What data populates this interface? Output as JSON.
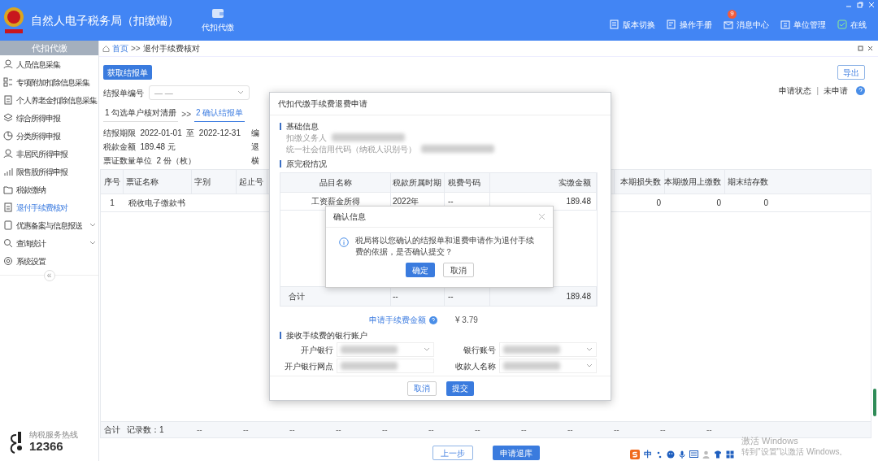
{
  "app": {
    "title": "自然人电子税务局（扣缴端）",
    "module_tab": "代扣代缴"
  },
  "header_actions": [
    {
      "label": "版本切换"
    },
    {
      "label": "操作手册"
    },
    {
      "label": "消息中心",
      "badge": "9"
    },
    {
      "label": "单位管理"
    },
    {
      "label": "在线"
    }
  ],
  "sidebar": {
    "title": "代扣代缴",
    "items": [
      {
        "label": "人员信息采集",
        "selected": false,
        "expandable": false
      },
      {
        "label": "专项附加扣除信息采集",
        "selected": false,
        "expandable": false
      },
      {
        "label": "个人养老金扣除信息采集",
        "selected": false,
        "expandable": false
      },
      {
        "label": "综合所得申报",
        "selected": false,
        "expandable": false
      },
      {
        "label": "分类所得申报",
        "selected": false,
        "expandable": false
      },
      {
        "label": "非居民所得申报",
        "selected": false,
        "expandable": false
      },
      {
        "label": "限售股所得申报",
        "selected": false,
        "expandable": false
      },
      {
        "label": "税款缴纳",
        "selected": false,
        "expandable": false
      },
      {
        "label": "退付手续费核对",
        "selected": true,
        "expandable": false
      },
      {
        "label": "优惠备案与信息报送",
        "selected": false,
        "expandable": true
      },
      {
        "label": "查询统计",
        "selected": false,
        "expandable": true
      },
      {
        "label": "系统设置",
        "selected": false,
        "expandable": false
      }
    ],
    "collapse": "«",
    "hotline_label": "纳税服务热线",
    "hotline": "12366"
  },
  "breadcrumb": {
    "home": "首页",
    "separator": ">>",
    "current": "退付手续费核对"
  },
  "toolbar": {
    "fetch_button": "获取结报单",
    "export_button": "导出",
    "status_label": "申请状态",
    "status_separator": "|",
    "status_value": "未申请"
  },
  "report_no": {
    "label": "结报单编号",
    "placeholder": "— —"
  },
  "steps": [
    {
      "label": "1 勾选单户核对清册",
      "selected": false
    },
    {
      "label": "2 确认结报单",
      "selected": true
    }
  ],
  "step_separator": ">>",
  "summary": [
    {
      "label": "结报期限",
      "value": "2022-01-01  至  2022-12-31",
      "cut": "编"
    },
    {
      "label": "税款金额",
      "value": "189.48 元",
      "cut": "退"
    },
    {
      "label": "票证数量单位",
      "value": "2 份（枚）",
      "cut": "横"
    }
  ],
  "table": {
    "columns_left": [
      "序号",
      "票证名称",
      "字别",
      "起止号"
    ],
    "columns_right": [
      "本期损失数",
      "本期缴用上缴数",
      "期末结存数"
    ],
    "rows": [
      {
        "index": "1",
        "name": "税收电子缴款书",
        "tail": [
          "0",
          "0",
          "0"
        ]
      }
    ],
    "footer": {
      "label": "合计",
      "count": "记录数：1",
      "cells": [
        "--",
        "--",
        "--",
        "--",
        "--",
        "--",
        "--",
        "--",
        "--",
        "--",
        "--",
        "--"
      ]
    }
  },
  "bottom_buttons": [
    {
      "label": "上一步",
      "primary": false
    },
    {
      "label": "申请退库",
      "primary": true
    }
  ],
  "refund_dialog": {
    "title": "代扣代缴手续费退费申请",
    "basic_section": "基础信息",
    "basic_fields": [
      {
        "label": "扣缴义务人",
        "blurred": true
      },
      {
        "label": "统一社会信用代码（纳税人识别号）",
        "blurred": true
      }
    ],
    "tax_section": "原完税情况",
    "tax_table": {
      "columns": [
        "品目名称",
        "税款所属时期",
        "税费号码",
        "实缴金额"
      ],
      "rows": [
        [
          "工资薪金所得",
          "2022年",
          "--",
          "189.48"
        ]
      ],
      "total": [
        "合计",
        "--",
        "--",
        "189.48"
      ]
    },
    "fee_label": "申请手续费金额",
    "fee_value": "¥ 3.79",
    "bank_section": "接收手续费的银行账户",
    "bank_fields": [
      {
        "label": "开户银行",
        "kind": "select",
        "blurred": true
      },
      {
        "label": "银行账号",
        "kind": "select",
        "blurred": true
      },
      {
        "label": "开户银行网点",
        "kind": "input",
        "blurred": true
      },
      {
        "label": "收款人名称",
        "kind": "select",
        "blurred": true
      }
    ],
    "buttons": [
      {
        "label": "取消",
        "primary": false
      },
      {
        "label": "提交",
        "primary": true
      }
    ]
  },
  "confirm_dialog": {
    "title": "确认信息",
    "message": "税局将以您确认的结报单和退费申请作为退付手续费的依据，是否确认提交？",
    "buttons": [
      {
        "label": "确定",
        "primary": true
      },
      {
        "label": "取消",
        "primary": false
      }
    ]
  },
  "os_watermark": {
    "title": "激活 Windows",
    "hint": "转到\"设置\"以激活 Windows。"
  },
  "ime_bar": {
    "mode": "中"
  }
}
